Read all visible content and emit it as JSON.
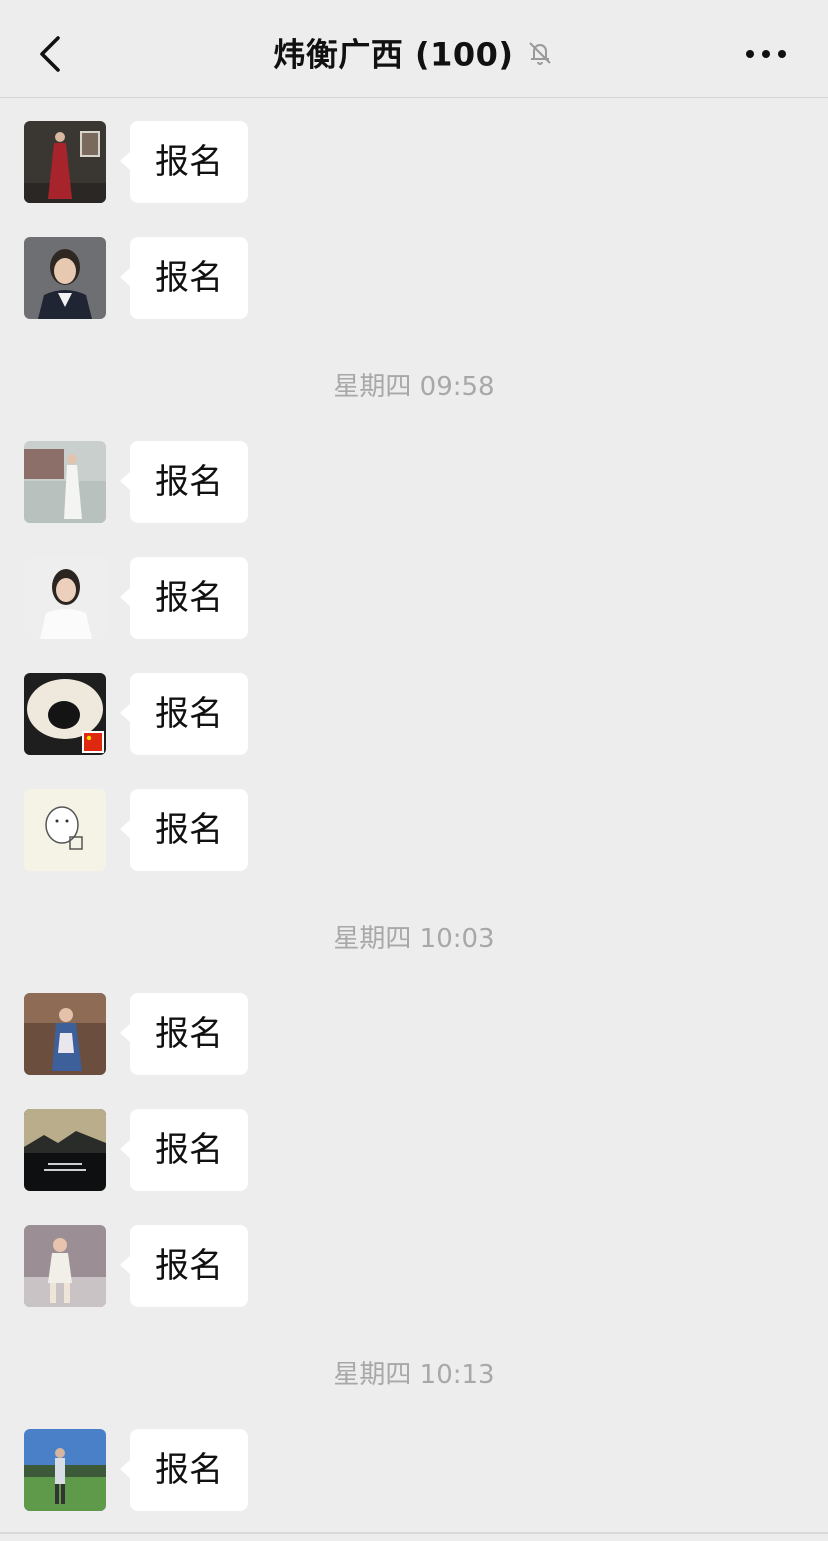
{
  "header": {
    "back_icon": "chevron-left-icon",
    "title": "炜衡广西 (100)",
    "mute_icon": "bell-off-icon",
    "more_icon": "ellipsis-icon"
  },
  "messages": [
    {
      "text": "报名",
      "avatar": "avatar-woman-red-dress"
    },
    {
      "text": "报名",
      "avatar": "avatar-woman-suit"
    },
    {
      "text": "报名",
      "avatar": "avatar-woman-white-dress-street"
    },
    {
      "text": "报名",
      "avatar": "avatar-woman-white-shirt"
    },
    {
      "text": "报名",
      "avatar": "avatar-dog-closeup"
    },
    {
      "text": "报名",
      "avatar": "avatar-cartoon-figure"
    },
    {
      "text": "报名",
      "avatar": "avatar-woman-seated"
    },
    {
      "text": "报名",
      "avatar": "avatar-sunset-landscape"
    },
    {
      "text": "报名",
      "avatar": "avatar-child-dancing"
    },
    {
      "text": "报名",
      "avatar": "avatar-man-golf-course"
    }
  ],
  "timestamps": [
    "星期四 09:58",
    "星期四 10:03",
    "星期四 10:13"
  ],
  "colors": {
    "background": "#ededed",
    "bubble": "#ffffff",
    "timestamp": "#a8a8a8"
  }
}
